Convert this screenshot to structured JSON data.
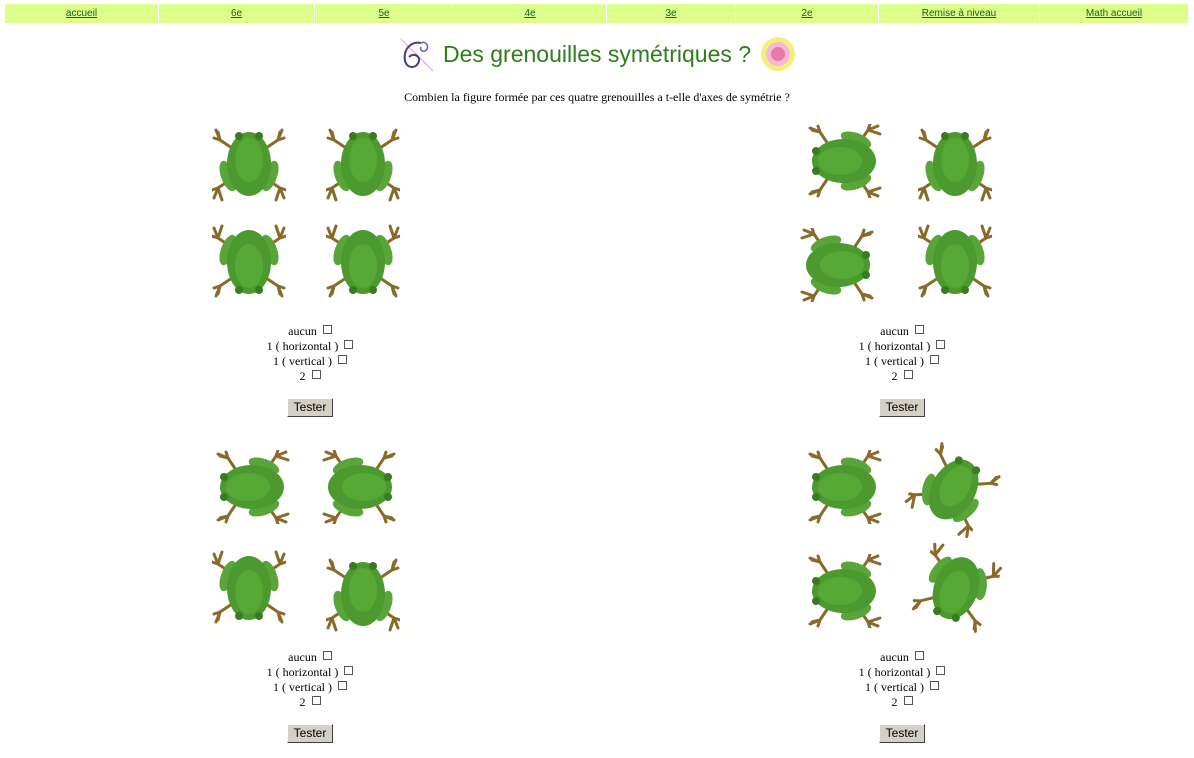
{
  "nav": {
    "items": [
      "accueil",
      "6e",
      "5e",
      "4e",
      "3e",
      "2e",
      "Remise à niveau",
      "Math accueil"
    ]
  },
  "header": {
    "title": "Des grenouilles symétriques ?",
    "left_logo_icon": "six-swirl-logo-icon",
    "right_logo_icon": "eqi-badge-icon"
  },
  "question": "Combien la figure formée par ces quatre grenouilles a t-elle d'axes de symétrie ?",
  "exercises": [
    {
      "options": [
        "aucun",
        "1 ( horizontal )",
        "1 ( vertical )",
        "2"
      ],
      "button": "Tester"
    },
    {
      "options": [
        "aucun",
        "1 ( horizontal )",
        "1 ( vertical )",
        "2"
      ],
      "button": "Tester"
    },
    {
      "options": [
        "aucun",
        "1 ( horizontal )",
        "1 ( vertical )",
        "2"
      ],
      "button": "Tester"
    },
    {
      "options": [
        "aucun",
        "1 ( horizontal )",
        "1 ( vertical )",
        "2"
      ],
      "button": "Tester"
    }
  ],
  "colors": {
    "nav_bg": "#dcff8c",
    "title": "#2f7e1a",
    "frog": "#4c9a2f"
  }
}
